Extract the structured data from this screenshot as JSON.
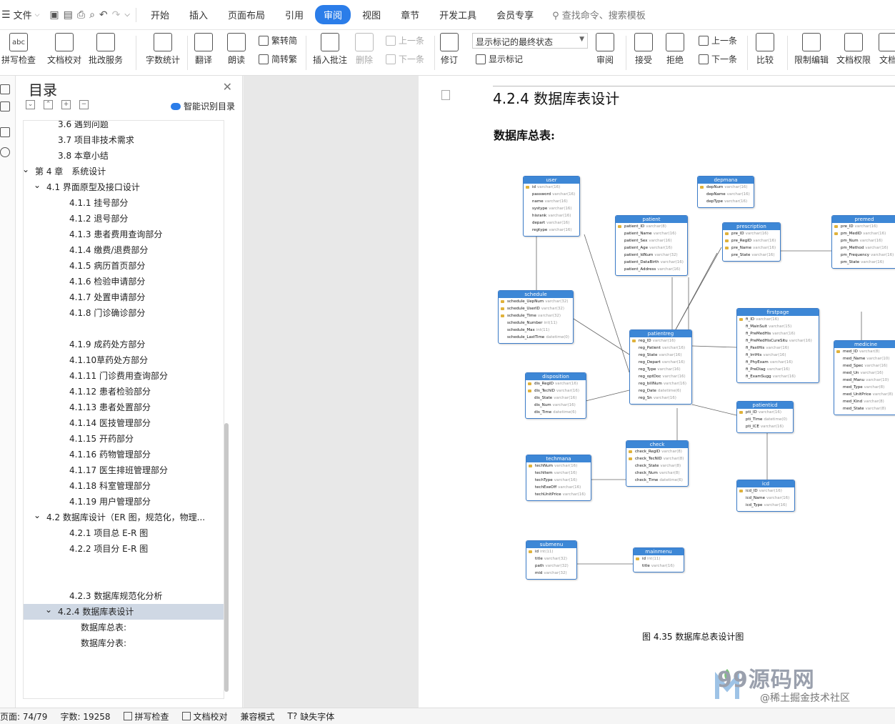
{
  "menubar": {
    "file_label": "文件",
    "tabs": [
      "开始",
      "插入",
      "页面布局",
      "引用",
      "审阅",
      "视图",
      "章节",
      "开发工具",
      "会员专享"
    ],
    "active_tab": "审阅",
    "search_placeholder": "查找命令、搜索模板"
  },
  "ribbon": {
    "spell_check": "拼写检查",
    "doc_proof": "文档校对",
    "annot_service": "批改服务",
    "word_count": "字数统计",
    "translate": "翻译",
    "read_aloud": "朗读",
    "trad": "繁转简",
    "simp": "简转繁",
    "insert_comment": "插入批注",
    "delete": "删除",
    "prev": "上一条",
    "next": "下一条",
    "revise": "修订",
    "markup_state": "显示标记的最终状态",
    "show_markup": "显示标记",
    "review": "审阅",
    "accept": "接受",
    "reject": "拒绝",
    "prev2": "上一条",
    "next2": "下一条",
    "compare": "比较",
    "restrict": "限制编辑",
    "doc_perm": "文档权限",
    "doc_more": "文档"
  },
  "toc": {
    "title": "目录",
    "smart": "智能识别目录",
    "items": [
      {
        "text": "3.6 遇到问题",
        "indent": 1
      },
      {
        "text": "3.7 项目非技术需求",
        "indent": 1
      },
      {
        "text": "3.8 本章小结",
        "indent": 1
      },
      {
        "text": "第 4 章　系统设计",
        "indent": 0,
        "caret": true
      },
      {
        "text": "4.1  界面原型及接口设计",
        "indent": 1,
        "caret": true
      },
      {
        "text": "4.1.1  挂号部分",
        "indent": 2
      },
      {
        "text": "4.1.2  退号部分",
        "indent": 2
      },
      {
        "text": "4.1.3  患者费用查询部分",
        "indent": 2
      },
      {
        "text": "4.1.4  缴费/退费部分",
        "indent": 2
      },
      {
        "text": "4.1.5  病历首页部分",
        "indent": 2
      },
      {
        "text": "4.1.6  检验申请部分",
        "indent": 2
      },
      {
        "text": "4.1.7  处置申请部分",
        "indent": 2
      },
      {
        "text": "4.1.8  门诊确诊部分",
        "indent": 2
      },
      {
        "text": "",
        "indent": 2
      },
      {
        "text": "4.1.9  成药处方部分",
        "indent": 2
      },
      {
        "text": "4.1.10草药处方部分",
        "indent": 2
      },
      {
        "text": "4.1.11 门诊费用查询部分",
        "indent": 2
      },
      {
        "text": "4.1.12 患者检验部分",
        "indent": 2
      },
      {
        "text": "4.1.13 患者处置部分",
        "indent": 2
      },
      {
        "text": "4.1.14 医技管理部分",
        "indent": 2
      },
      {
        "text": "4.1.15 开药部分",
        "indent": 2
      },
      {
        "text": "4.1.16 药物管理部分",
        "indent": 2
      },
      {
        "text": "4.1.17 医生排班管理部分",
        "indent": 2
      },
      {
        "text": "4.1.18 科室管理部分",
        "indent": 2
      },
      {
        "text": "4.1.19 用户管理部分",
        "indent": 2
      },
      {
        "text": "4.2  数据库设计（ER 图，规范化，物理...",
        "indent": 1,
        "caret": true
      },
      {
        "text": "4.2.1 项目总 E-R 图",
        "indent": 2
      },
      {
        "text": "4.2.2 项目分 E-R 图",
        "indent": 2
      },
      {
        "text": "",
        "indent": 2
      },
      {
        "text": "",
        "indent": 2
      },
      {
        "text": "4.2.3 数据库规范化分析",
        "indent": 2
      },
      {
        "text": "4.2.4 数据库表设计",
        "indent": 2,
        "caret": true,
        "selected": true
      },
      {
        "text": "数据库总表:",
        "indent": 3
      },
      {
        "text": "数据库分表:",
        "indent": 3
      }
    ]
  },
  "document": {
    "heading": "4.2.4 数据库表设计",
    "subheading": "数据库总表:",
    "caption": "图 4.35 数据库总表设计图",
    "watermark": "99源码网",
    "watermark_sub": "@稀土掘金技术社区"
  },
  "er_tables": [
    {
      "name": "user",
      "rows": [
        [
          "id",
          "varchar(16)",
          1
        ],
        [
          "password",
          "varchar(16)",
          0
        ],
        [
          "name",
          "varchar(16)",
          0
        ],
        [
          "systype",
          "varchar(16)",
          0
        ],
        [
          "hisrank",
          "varchar(16)",
          0
        ],
        [
          "depart",
          "varchar(16)",
          0
        ],
        [
          "regtype",
          "varchar(16)",
          0
        ]
      ]
    },
    {
      "name": "depmana",
      "rows": [
        [
          "depNum",
          "varchar(16)",
          1
        ],
        [
          "depName",
          "varchar(16)",
          0
        ],
        [
          "depType",
          "varchar(16)",
          0
        ]
      ]
    },
    {
      "name": "patient",
      "rows": [
        [
          "patient_ID",
          "varchar(8)",
          1
        ],
        [
          "patient_Name",
          "varchar(16)",
          0
        ],
        [
          "patient_Sex",
          "varchar(16)",
          0
        ],
        [
          "patient_Age",
          "varchar(16)",
          0
        ],
        [
          "patient_IdNum",
          "varchar(32)",
          0
        ],
        [
          "patient_DataBirth",
          "varchar(16)",
          0
        ],
        [
          "patient_Address",
          "varchar(16)",
          0
        ]
      ]
    },
    {
      "name": "prescription",
      "rows": [
        [
          "pre_ID",
          "varchar(16)",
          1
        ],
        [
          "pre_RegID",
          "varchar(16)",
          1
        ],
        [
          "pre_Name",
          "varchar(16)",
          1
        ],
        [
          "pre_State",
          "varchar(16)",
          0
        ]
      ]
    },
    {
      "name": "premed",
      "rows": [
        [
          "pre_ID",
          "varchar(16)",
          1
        ],
        [
          "pm_MedID",
          "varchar(16)",
          1
        ],
        [
          "pm_Num",
          "varchar(16)",
          0
        ],
        [
          "pm_Method",
          "varchar(16)",
          0
        ],
        [
          "pm_Frequency",
          "varchar(16)",
          0
        ],
        [
          "pm_State",
          "varchar(16)",
          0
        ]
      ]
    },
    {
      "name": "schedule",
      "rows": [
        [
          "schedule_UepNum",
          "varchar(32)",
          1
        ],
        [
          "schedule_UserID",
          "varchar(32)",
          1
        ],
        [
          "schedule_Time",
          "varchar(32)",
          1
        ],
        [
          "schedule_Number",
          "int(11)",
          0
        ],
        [
          "schedule_Max",
          "int(11)",
          0
        ],
        [
          "schedule_LastTime",
          "datetime(0)",
          0
        ]
      ]
    },
    {
      "name": "patientreg",
      "rows": [
        [
          "reg_ID",
          "varchar(16)",
          1
        ],
        [
          "reg_Patient",
          "varchar(16)",
          0
        ],
        [
          "reg_State",
          "varchar(16)",
          0
        ],
        [
          "reg_Depart",
          "varchar(16)",
          0
        ],
        [
          "reg_Type",
          "varchar(16)",
          0
        ],
        [
          "reg_optDoc",
          "varchar(16)",
          0
        ],
        [
          "reg_billNum",
          "varchar(16)",
          0
        ],
        [
          "reg_Date",
          "datetime(6)",
          0
        ],
        [
          "reg_Sn",
          "varchar(16)",
          0
        ]
      ]
    },
    {
      "name": "firstpage",
      "rows": [
        [
          "fi_ID",
          "varchar(16)",
          1
        ],
        [
          "fi_MainSuit",
          "varchar(15)",
          0
        ],
        [
          "fi_PreMedHis",
          "varchar(16)",
          0
        ],
        [
          "fi_PreMedHisCureSitu",
          "varchar(16)",
          0
        ],
        [
          "fi_PastHis",
          "varchar(16)",
          0
        ],
        [
          "fi_IrriHis",
          "varchar(16)",
          0
        ],
        [
          "fi_PhyExam",
          "varchar(16)",
          0
        ],
        [
          "fi_PreDiag",
          "varchar(16)",
          0
        ],
        [
          "fi_ExamSugg",
          "varchar(16)",
          0
        ]
      ]
    },
    {
      "name": "medicine",
      "rows": [
        [
          "med_ID",
          "varchar(8)",
          1
        ],
        [
          "med_Name",
          "varchar(10)",
          0
        ],
        [
          "med_Spec",
          "varchar(16)",
          0
        ],
        [
          "med_Un",
          "varchar(16)",
          0
        ],
        [
          "med_Manu",
          "varchar(10)",
          0
        ],
        [
          "med_Type",
          "varchar(8)",
          0
        ],
        [
          "med_UnitPrice",
          "varchar(8)",
          0
        ],
        [
          "med_Kind",
          "varchar(8)",
          0
        ],
        [
          "med_State",
          "varchar(8)",
          0
        ]
      ]
    },
    {
      "name": "disposition",
      "rows": [
        [
          "dis_RegID",
          "varchar(16)",
          1
        ],
        [
          "dis_TechID",
          "varchar(16)",
          1
        ],
        [
          "dis_State",
          "varchar(16)",
          0
        ],
        [
          "dis_Num",
          "varchar(16)",
          0
        ],
        [
          "dis_Time",
          "datetime(6)",
          0
        ]
      ]
    },
    {
      "name": "patienticd",
      "rows": [
        [
          "pti_ID",
          "varchar(16)",
          1
        ],
        [
          "pti_Time",
          "datetime(0)",
          0
        ],
        [
          "pti_ICE",
          "varchar(16)",
          0
        ]
      ]
    },
    {
      "name": "check",
      "rows": [
        [
          "check_RegID",
          "varchar(8)",
          1
        ],
        [
          "check_TecNID",
          "varchar(8)",
          1
        ],
        [
          "check_State",
          "varchar(8)",
          0
        ],
        [
          "check_Num",
          "varchar(8)",
          0
        ],
        [
          "check_Time",
          "datetime(6)",
          0
        ]
      ]
    },
    {
      "name": "techmana",
      "rows": [
        [
          "techNum",
          "varchar(16)",
          1
        ],
        [
          "techItem",
          "varchar(16)",
          0
        ],
        [
          "techType",
          "varchar(16)",
          0
        ],
        [
          "techExeOff",
          "varchar(16)",
          0
        ],
        [
          "techUnitPrice",
          "varchar(16)",
          0
        ]
      ]
    },
    {
      "name": "icd",
      "rows": [
        [
          "icd_ID",
          "varchar(16)",
          1
        ],
        [
          "icd_Name",
          "varchar(16)",
          0
        ],
        [
          "icd_Type",
          "varchar(16)",
          0
        ]
      ]
    },
    {
      "name": "submenu",
      "rows": [
        [
          "id",
          "int(11)",
          1
        ],
        [
          "title",
          "varchar(32)",
          0
        ],
        [
          "path",
          "varchar(32)",
          0
        ],
        [
          "mid",
          "varchar(32)",
          0
        ]
      ]
    },
    {
      "name": "mainmenu",
      "rows": [
        [
          "id",
          "int(11)",
          1
        ],
        [
          "title",
          "varchar(16)",
          0
        ]
      ]
    }
  ],
  "status": {
    "page": "页面: 74/79",
    "words": "字数: 19258",
    "spell": "拼写检查",
    "proof": "文档校对",
    "compat": "兼容模式",
    "missing_font": "缺失字体"
  }
}
